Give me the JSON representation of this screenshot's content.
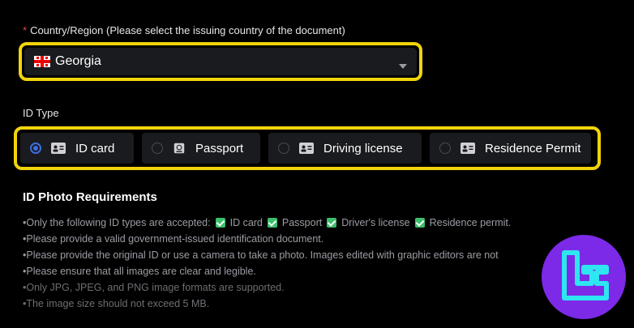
{
  "country": {
    "required_mark": "*",
    "label": "Country/Region (Please select the issuing country of the document)",
    "selected": "Georgia",
    "flag_icon": "georgia-flag-icon",
    "chevron_icon": "chevron-down-icon"
  },
  "id_type": {
    "label": "ID Type",
    "options": [
      {
        "label": "ID card",
        "icon": "id-card-icon",
        "selected": true
      },
      {
        "label": "Passport",
        "icon": "passport-icon",
        "selected": false
      },
      {
        "label": "Driving license",
        "icon": "driving-license-icon",
        "selected": false
      },
      {
        "label": "Residence Permit",
        "icon": "residence-permit-icon",
        "selected": false
      }
    ]
  },
  "requirements": {
    "title": "ID Photo Requirements",
    "item1_prefix": "•Only the following ID types are accepted:",
    "accepted": [
      "ID card",
      "Passport",
      "Driver's license",
      "Residence permit."
    ],
    "items": [
      "•Please provide a valid government-issued identification document.",
      "•Please provide the original ID or use a camera to take a photo. Images edited with graphic editors are not",
      "•Please ensure that all images are clear and legible.",
      "•Only JPG, JPEG, and PNG image formats are supported.",
      "•The image size should not exceed 5 MB."
    ]
  },
  "colors": {
    "highlight": "#f2d40c",
    "radio_selected": "#3a6fe0",
    "checkbox": "#3bbf6b",
    "logo_bg": "#7c2ae8",
    "logo_fg": "#2ee6f0"
  },
  "logo": {
    "icon": "tradingfinder-logo-icon"
  }
}
